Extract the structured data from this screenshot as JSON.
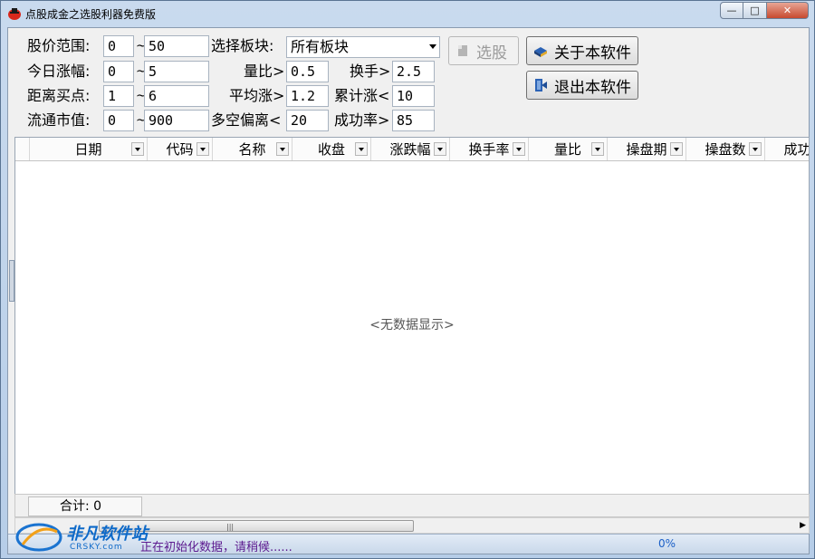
{
  "window": {
    "title": "点股成金之选股利器免费版",
    "min_glyph": "—",
    "max_glyph": "□",
    "close_glyph": "✕"
  },
  "filters": {
    "price_label": "股价范围:",
    "price_from": "0",
    "price_to": "50",
    "change_label": "今日涨幅:",
    "change_from": "0",
    "change_to": "5",
    "buy_label": "距离买点:",
    "buy_from": "1",
    "buy_to": "6",
    "cap_label": "流通市值:",
    "cap_from": "0",
    "cap_to": "900",
    "tilde": "~",
    "sector_label": "选择板块:",
    "sector_value": "所有板块",
    "volume_ratio_label": "量比>",
    "volume_ratio_value": "0.5",
    "turnover_label": "换手>",
    "turnover_value": "2.5",
    "avg_gain_label": "平均涨>",
    "avg_gain_value": "1.2",
    "cum_gain_label": "累计涨<",
    "cum_gain_value": "10",
    "bias_label": "多空偏离<",
    "bias_value": "20",
    "success_label": "成功率>",
    "success_value": "85"
  },
  "buttons": {
    "select_label": "选股",
    "about_label": "关于本软件",
    "exit_label": "退出本软件"
  },
  "grid": {
    "columns": [
      "日期",
      "代码",
      "名称",
      "收盘",
      "涨跌幅",
      "换手率",
      "量比",
      "操盘期",
      "操盘数",
      "成功数"
    ],
    "empty_text": "<无数据显示>",
    "sum_label": "合计: 0"
  },
  "status": {
    "text": "正在初始化数据，请稍候......",
    "progress_text": "0%",
    "progress": 0
  },
  "watermark": {
    "brand": "非凡软件站",
    "sub": "CRSKY.com"
  },
  "colors": {
    "title_bg": "#c9daee",
    "close_red": "#c74a2f",
    "status_text": "#5c1a8f",
    "status_pct": "#1a5fc7"
  }
}
